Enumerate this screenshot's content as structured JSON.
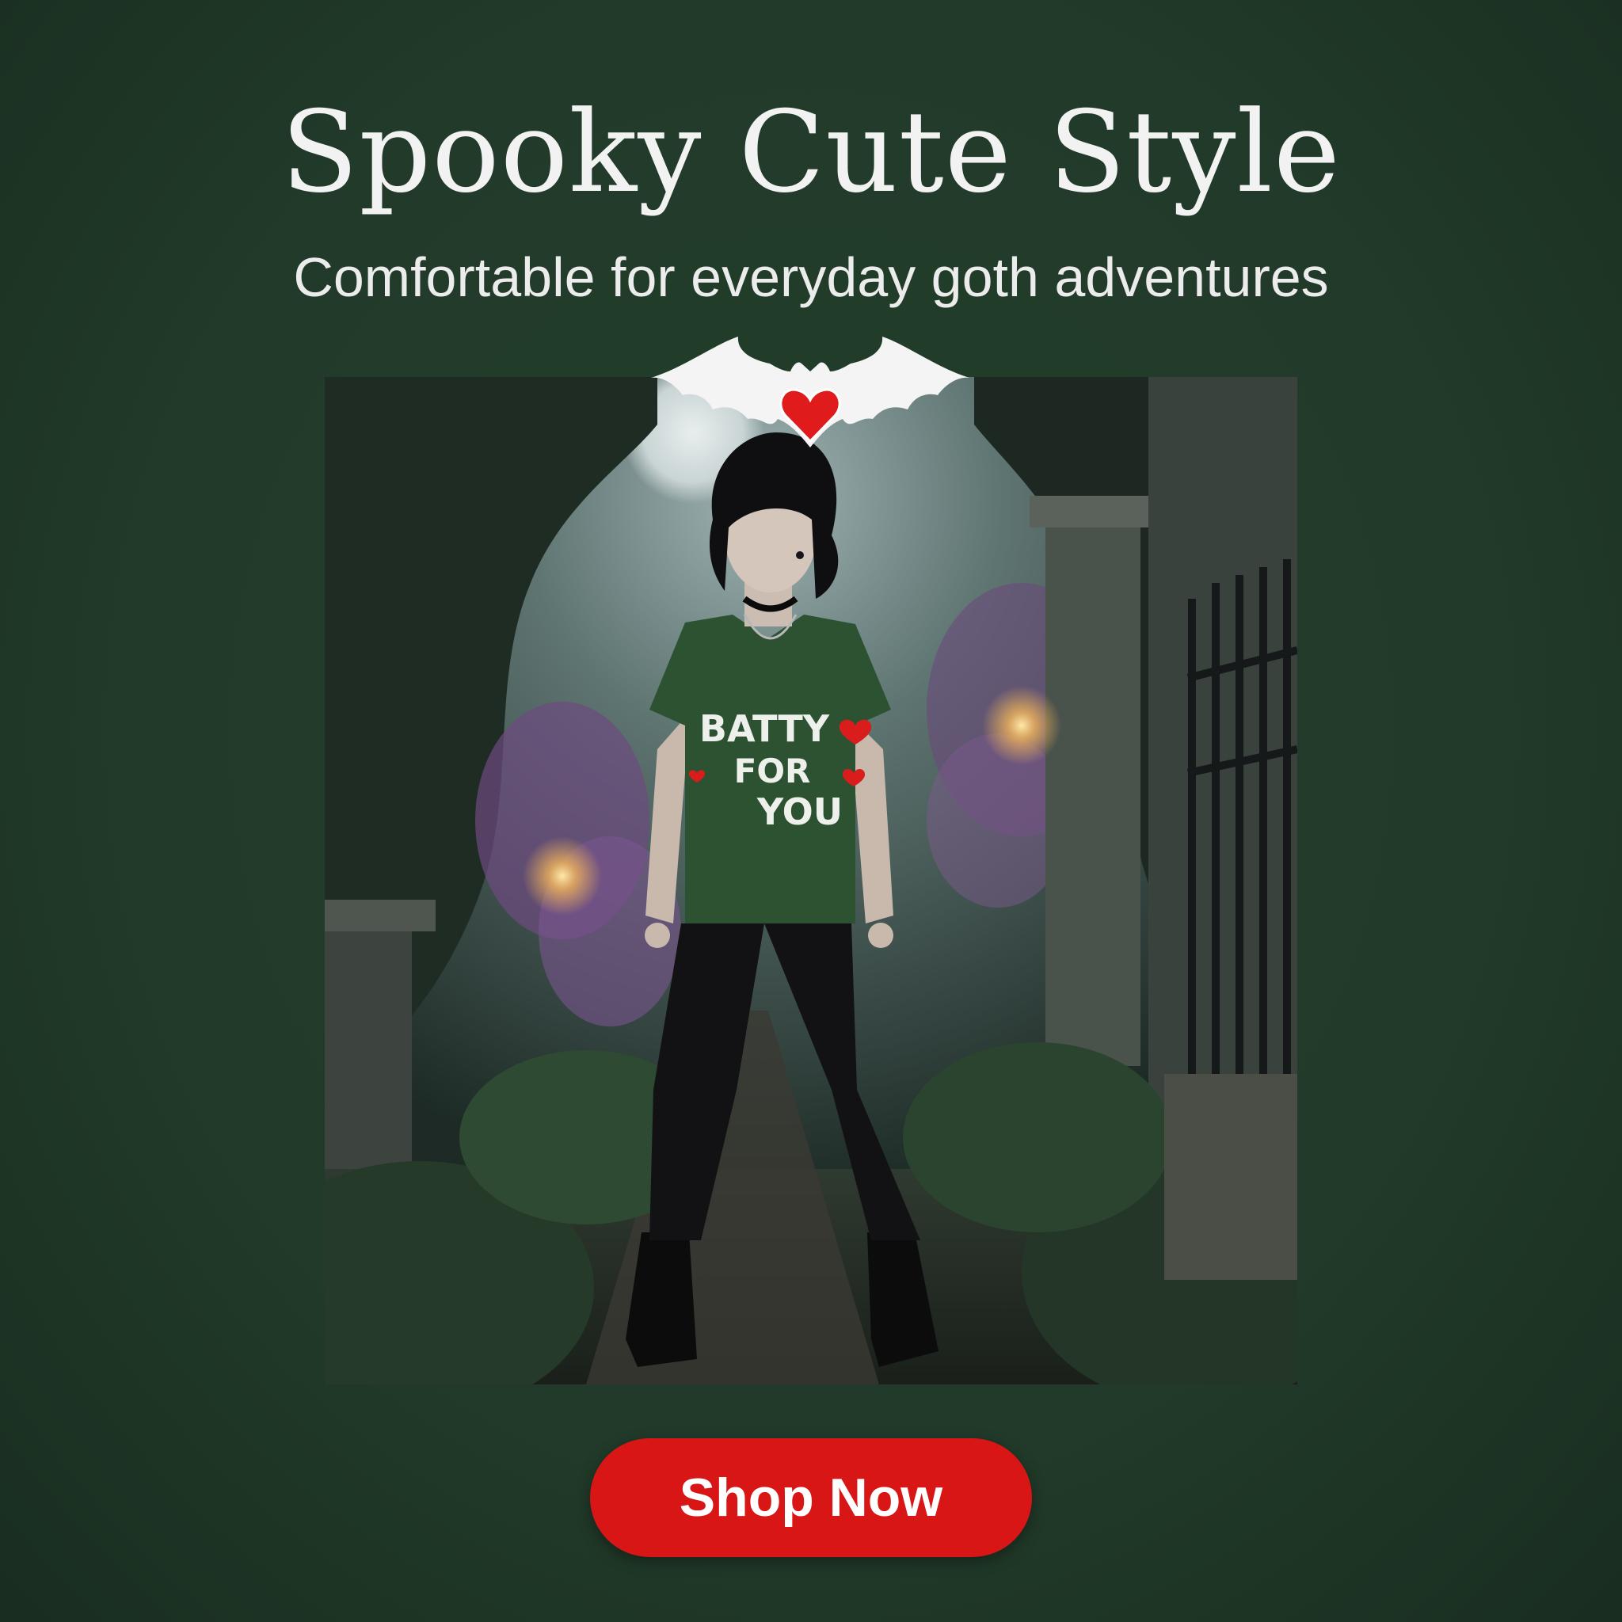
{
  "headline": "Spooky Cute Style",
  "subheadline": "Comfortable for everyday goth adventures",
  "product_photo": {
    "shirt_text_line1": "BATTY",
    "shirt_text_line2": "FOR",
    "shirt_text_line3": "YOU",
    "shirt_color": "#2d5231"
  },
  "badge_icon": "bat-heart-icon",
  "cta": {
    "label": "Shop Now",
    "color": "#d81616"
  },
  "colors": {
    "background": "#213a29",
    "text": "#f2f2f2",
    "heart": "#e01b1b"
  }
}
